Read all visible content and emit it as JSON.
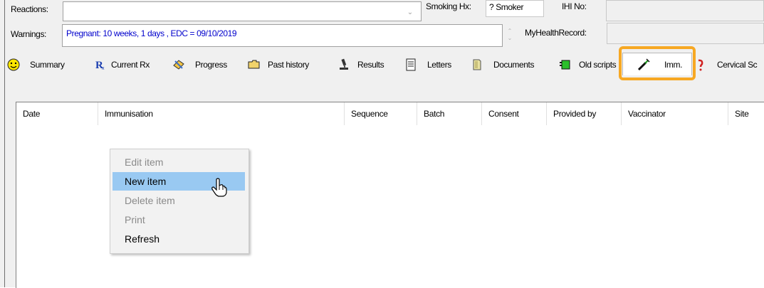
{
  "header": {
    "reactions_label": "Reactions:",
    "warnings_label": "Warnings:",
    "warnings_value": "Pregnant:  10 weeks, 1 days , EDC = 09/10/2019",
    "smoking_label": "Smoking Hx:",
    "smoking_value": "? Smoker",
    "ihi_label": "IHI No:",
    "mhr_label": "MyHealthRecord:"
  },
  "tabs": [
    {
      "label": "Summary",
      "icon": "smiley-icon"
    },
    {
      "label": "Current Rx",
      "icon": "rx-icon"
    },
    {
      "label": "Progress",
      "icon": "progress-notes-icon"
    },
    {
      "label": "Past history",
      "icon": "folder-icon"
    },
    {
      "label": "Results",
      "icon": "microscope-icon"
    },
    {
      "label": "Letters",
      "icon": "letter-icon"
    },
    {
      "label": "Documents",
      "icon": "documents-icon"
    },
    {
      "label": "Old scripts",
      "icon": "old-scripts-icon"
    },
    {
      "label": "Imm.",
      "icon": "syringe-icon",
      "active": true
    },
    {
      "label": "Cervical Sc",
      "icon": "cervical-icon"
    }
  ],
  "grid": {
    "columns": [
      "Date",
      "Immunisation",
      "Sequence",
      "Batch",
      "Consent",
      "Provided by",
      "Vaccinator",
      "Site"
    ],
    "rows": []
  },
  "context_menu": {
    "items": [
      {
        "label": "Edit item",
        "enabled": false
      },
      {
        "label": "New item",
        "enabled": true,
        "highlighted": true
      },
      {
        "label": "Delete item",
        "enabled": false
      },
      {
        "label": "Print",
        "enabled": false
      },
      {
        "label": "Refresh",
        "enabled": true
      }
    ]
  },
  "colors": {
    "highlight_box": "#f7a823",
    "menu_hover": "#99c9f2",
    "warning_text": "#0000cc"
  }
}
